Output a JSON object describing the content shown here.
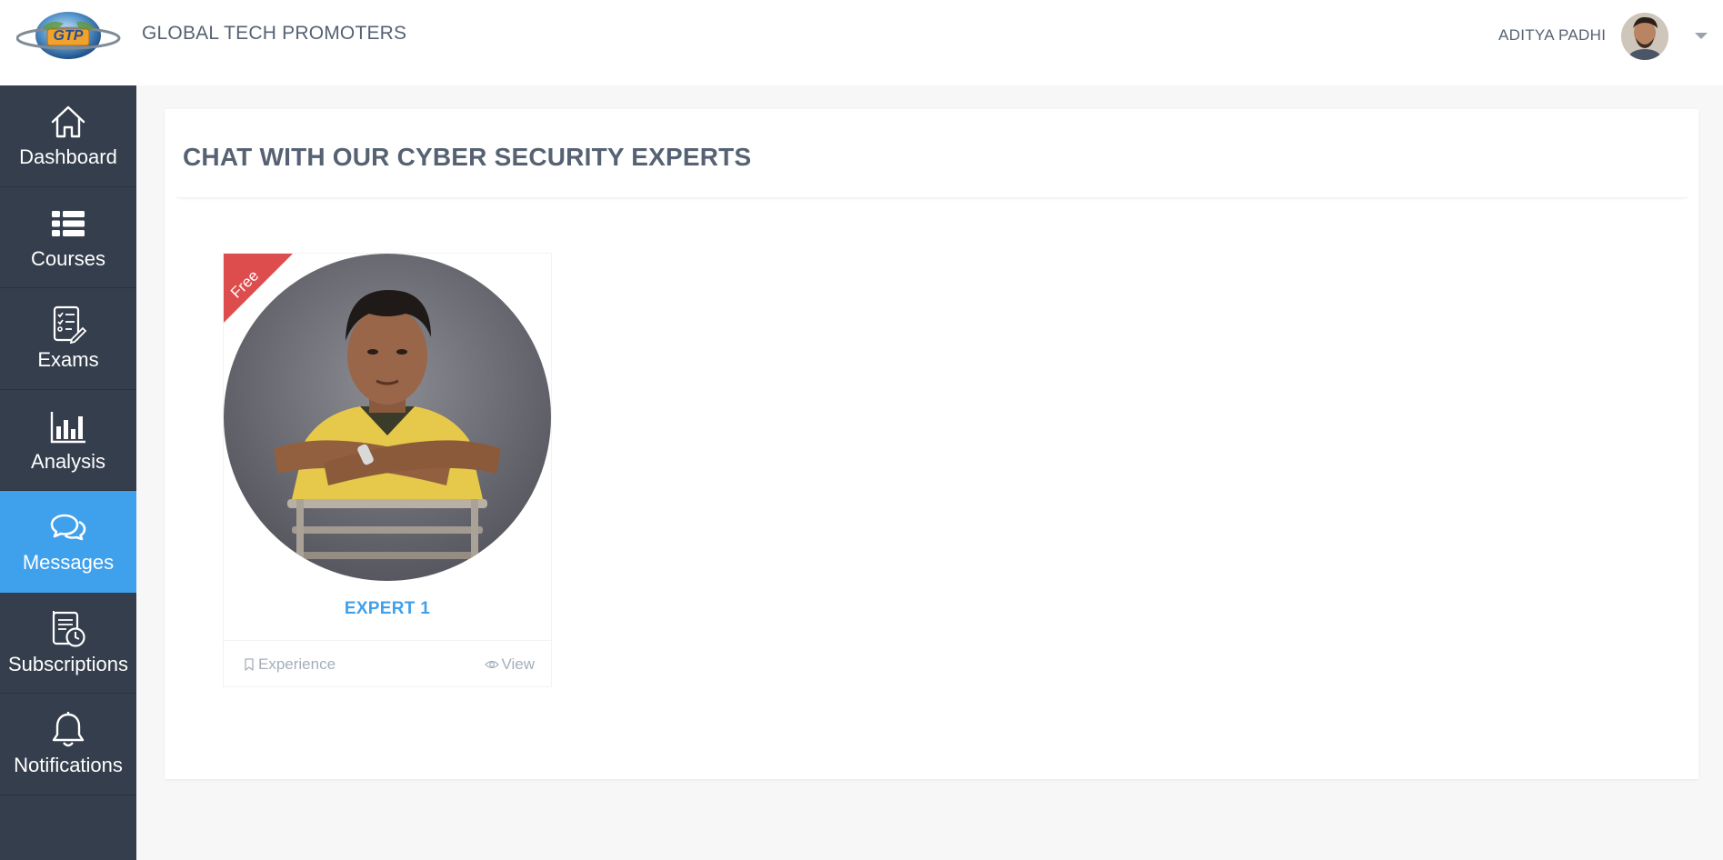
{
  "header": {
    "brand": "GLOBAL TECH PROMOTERS",
    "logo_text": "GTP",
    "user_name": "ADITYA PADHI"
  },
  "sidebar": {
    "items": [
      {
        "label": "Dashboard",
        "icon": "home-icon",
        "active": false
      },
      {
        "label": "Courses",
        "icon": "list-icon",
        "active": false
      },
      {
        "label": "Exams",
        "icon": "exam-checklist-icon",
        "active": false
      },
      {
        "label": "Analysis",
        "icon": "bar-chart-icon",
        "active": false
      },
      {
        "label": "Messages",
        "icon": "chat-bubbles-icon",
        "active": true
      },
      {
        "label": "Subscriptions",
        "icon": "subscription-clock-icon",
        "active": false
      },
      {
        "label": "Notifications",
        "icon": "bell-icon",
        "active": false
      }
    ]
  },
  "main": {
    "title": "CHAT WITH OUR CYBER SECURITY EXPERTS",
    "experts": [
      {
        "name": "EXPERT 1",
        "ribbon": "Free",
        "experience_label": "Experience",
        "view_label": "View"
      }
    ]
  },
  "colors": {
    "sidebar_bg": "#353e4c",
    "active_bg": "#3fa0ec",
    "accent": "#3fa0ec",
    "ribbon": "#de4d4d",
    "title_text": "#566273"
  }
}
